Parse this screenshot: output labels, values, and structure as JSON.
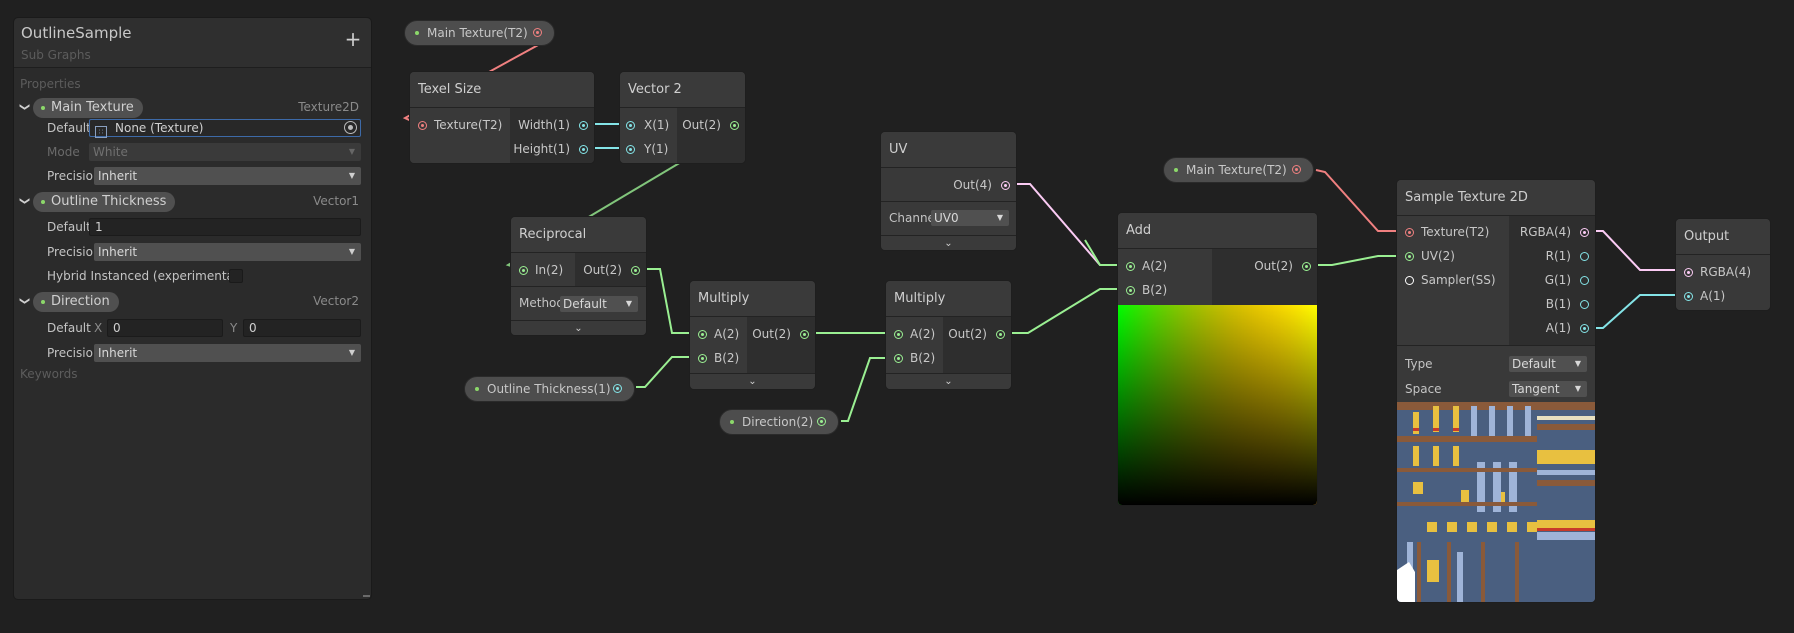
{
  "blackboard": {
    "title": "OutlineSample",
    "subtitle": "Sub Graphs",
    "add_icon": "plus-icon",
    "properties_label": "Properties",
    "keywords_label": "Keywords",
    "properties": [
      {
        "name": "Main Texture",
        "type": "Texture2D",
        "default_label": "Default",
        "default_value": "None (Texture)",
        "mode_label": "Mode",
        "mode_value": "White",
        "precision_label": "Precision",
        "precision_value": "Inherit"
      },
      {
        "name": "Outline Thickness",
        "type": "Vector1",
        "default_label": "Default",
        "default_value": "1",
        "precision_label": "Precision",
        "precision_value": "Inherit",
        "hybrid_label": "Hybrid Instanced (experimental)",
        "hybrid_checked": false
      },
      {
        "name": "Direction",
        "type": "Vector2",
        "default_label": "Default",
        "x_label": "X",
        "x_value": "0",
        "y_label": "Y",
        "y_value": "0",
        "precision_label": "Precision",
        "precision_value": "Inherit"
      }
    ]
  },
  "graph": {
    "colors": {
      "texture": "#f08080",
      "vector1": "#84e4e7",
      "vector2": "#9aef92",
      "vector4": "#fbcbf4",
      "sampler": "#ffffff"
    },
    "property_nodes": {
      "main_texture_top": "Main Texture(T2)",
      "main_texture_right": "Main Texture(T2)",
      "outline_thickness": "Outline Thickness(1)",
      "direction": "Direction(2)"
    },
    "texel_size": {
      "title": "Texel Size",
      "inputs": [
        "Texture(T2)"
      ],
      "outputs": [
        "Width(1)",
        "Height(1)"
      ]
    },
    "vector2": {
      "title": "Vector 2",
      "inputs": [
        "X(1)",
        "Y(1)"
      ],
      "outputs": [
        "Out(2)"
      ]
    },
    "reciprocal": {
      "title": "Reciprocal",
      "inputs": [
        "In(2)"
      ],
      "outputs": [
        "Out(2)"
      ],
      "setting_label": "Method",
      "setting_value": "Default"
    },
    "uv": {
      "title": "UV",
      "outputs": [
        "Out(4)"
      ],
      "setting_label": "Channel",
      "setting_value": "UV0"
    },
    "multiply1": {
      "title": "Multiply",
      "inputs": [
        "A(2)",
        "B(2)"
      ],
      "outputs": [
        "Out(2)"
      ]
    },
    "multiply2": {
      "title": "Multiply",
      "inputs": [
        "A(2)",
        "B(2)"
      ],
      "outputs": [
        "Out(2)"
      ]
    },
    "add": {
      "title": "Add",
      "inputs": [
        "A(2)",
        "B(2)"
      ],
      "outputs": [
        "Out(2)"
      ]
    },
    "sample_texture": {
      "title": "Sample Texture 2D",
      "inputs": [
        "Texture(T2)",
        "UV(2)",
        "Sampler(SS)"
      ],
      "outputs": [
        "RGBA(4)",
        "R(1)",
        "G(1)",
        "B(1)",
        "A(1)"
      ],
      "type_label": "Type",
      "type_value": "Default",
      "space_label": "Space",
      "space_value": "Tangent"
    },
    "output": {
      "title": "Output",
      "inputs": [
        "RGBA(4)",
        "A(1)"
      ]
    },
    "collapse_icon": "chevron-down-icon"
  }
}
